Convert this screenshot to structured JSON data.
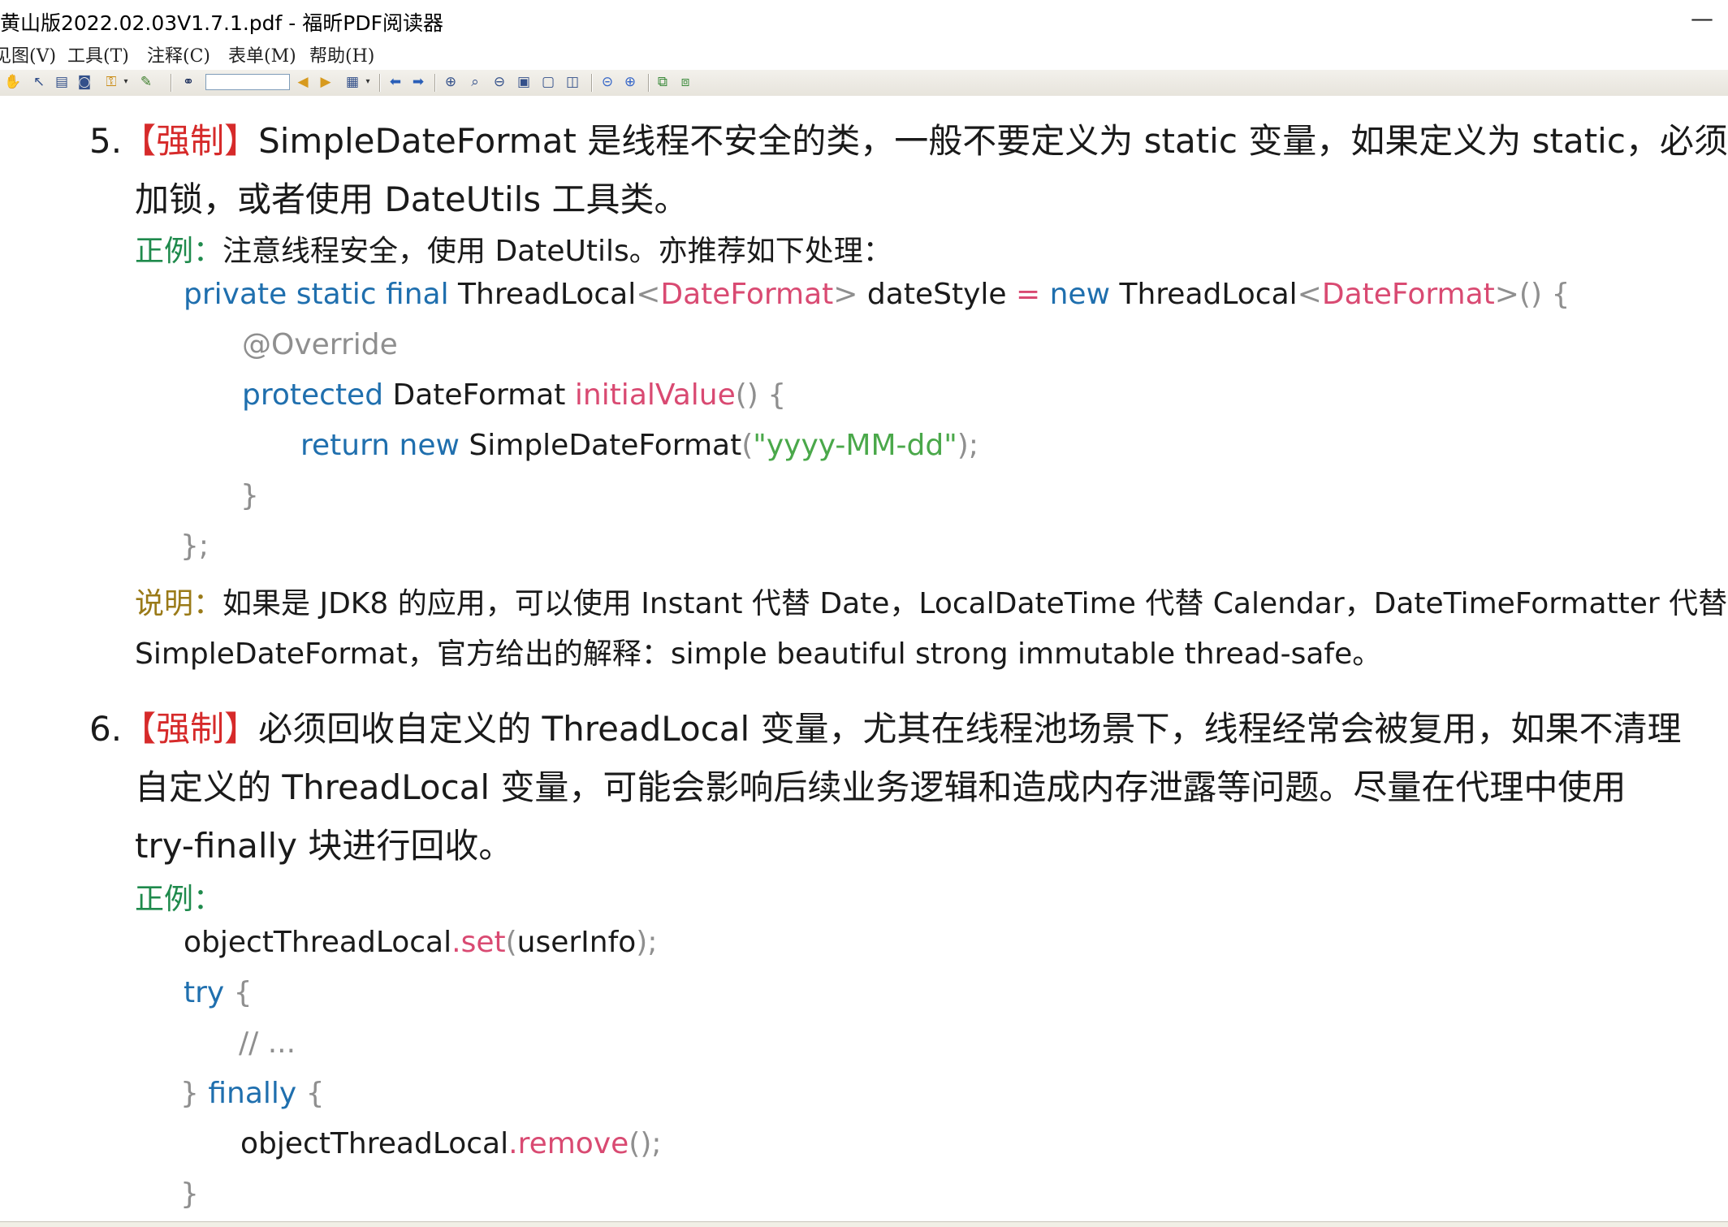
{
  "window": {
    "title": "黄山版2022.02.03V1.7.1.pdf - 福昕PDF阅读器",
    "minimize_glyph": "—"
  },
  "menu": {
    "items": [
      {
        "label": "见图(V)"
      },
      {
        "label": "工具(T)"
      },
      {
        "label": "注释(C)"
      },
      {
        "label": "表单(M)"
      },
      {
        "label": "帮助(H)"
      }
    ]
  },
  "toolbar": {
    "icons": [
      "hand-tool-icon",
      "select-arrow-icon",
      "select-text-icon",
      "snapshot-icon",
      "security-lock-icon",
      "dropdown-arrow-icon",
      "edit-pen-icon",
      "find-binoculars-icon",
      "find-previous-icon",
      "find-next-icon",
      "document-icon",
      "dropdown-arrow-icon",
      "back-arrow-icon",
      "forward-arrow-icon",
      "zoom-in-icon",
      "zoom-rectangle-icon",
      "zoom-out-icon",
      "actual-size-icon",
      "fit-page-icon",
      "fit-width-icon",
      "rotate-left-icon",
      "rotate-right-icon",
      "bookmark-icon",
      "layers-icon"
    ]
  },
  "document": {
    "item5": {
      "number": "5.",
      "tag": "【强制】",
      "line1": "SimpleDateFormat 是线程不安全的类，一般不要定义为 static 变量，如果定义为 static，必须",
      "line2": "加锁，或者使用 DateUtils 工具类。",
      "example_label": "正例：",
      "example_text": "注意线程安全，使用 DateUtils。亦推荐如下处理：",
      "code": {
        "l1": {
          "a": "private static final",
          "b": "ThreadLocal",
          "c": "<",
          "d": "DateFormat",
          "e": ">",
          "f": "dateStyle",
          "g": "=",
          "h": "new",
          "i": "ThreadLocal",
          "j": "<",
          "k": "DateFormat",
          "l": ">() {"
        },
        "l2": {
          "a": "@Override"
        },
        "l3": {
          "a": "protected",
          "b": "DateFormat",
          "c": "initialValue",
          "d": "() {"
        },
        "l4": {
          "a": "return new",
          "b": "SimpleDateFormat",
          "c": "(",
          "d": "\"yyyy-MM-dd\"",
          "e": ");"
        },
        "l5": {
          "a": "}"
        },
        "l6": {
          "a": "};"
        }
      },
      "note_label": "说明：",
      "note_line1": "如果是 JDK8 的应用，可以使用 Instant 代替 Date，LocalDateTime 代替 Calendar，DateTimeFormatter 代替",
      "note_line2": "SimpleDateFormat，官方给出的解释：simple beautiful strong immutable thread-safe。"
    },
    "item6": {
      "number": "6.",
      "tag": "【强制】",
      "line1": "必须回收自定义的 ThreadLocal 变量，尤其在线程池场景下，线程经常会被复用，如果不清理",
      "line2": "自定义的 ThreadLocal 变量，可能会影响后续业务逻辑和造成内存泄露等问题。尽量在代理中使用",
      "line3": "try-finally 块进行回收。",
      "example_label": "正例：",
      "code": {
        "l1": {
          "a": "objectThreadLocal",
          "b": ".set",
          "c": "(",
          "d": "userInfo",
          "e": ");"
        },
        "l2": {
          "a": "try",
          "b": " {"
        },
        "l3": {
          "a": "// ..."
        },
        "l4": {
          "a": "} ",
          "b": "finally",
          "c": " {"
        },
        "l5": {
          "a": "objectThreadLocal",
          "b": ".remove",
          "c": "();"
        },
        "l6": {
          "a": "}"
        }
      }
    }
  }
}
